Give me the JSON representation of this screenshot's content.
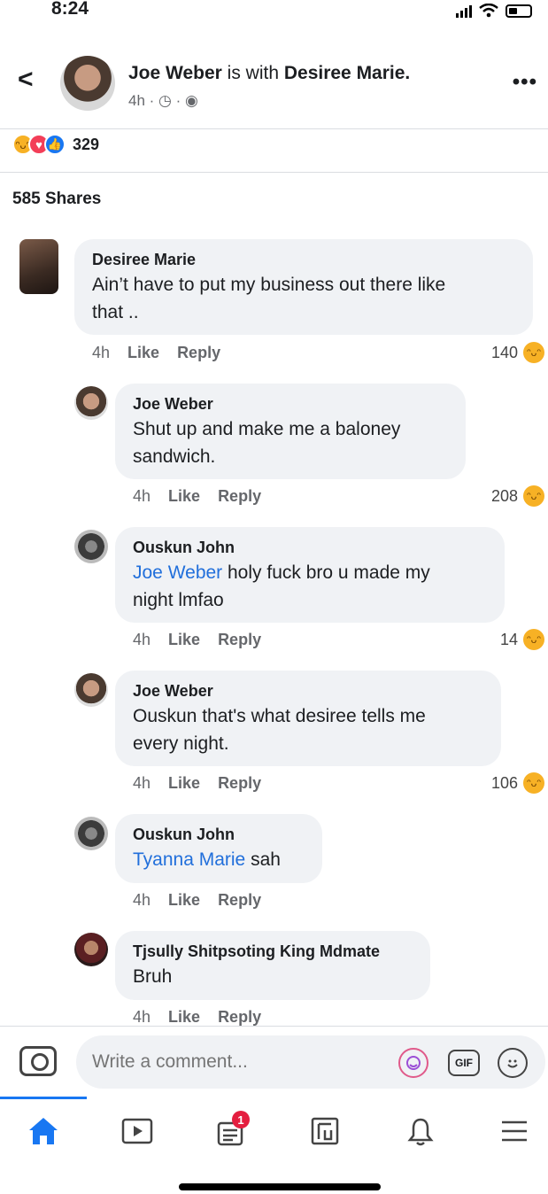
{
  "status_bar": {
    "time": "8:24"
  },
  "header": {
    "author": "Joe Weber",
    "with_text": " is with ",
    "tagged": "Desiree Marie.",
    "meta": "4h · ◷ · ◉"
  },
  "reactions": {
    "count": "329",
    "types": [
      "haha-icon",
      "love-icon",
      "like-icon"
    ]
  },
  "shares": "585 Shares",
  "comments": [
    {
      "name": "Desiree Marie",
      "text_lines": [
        "Ain’t have to put my business out there like",
        "that .."
      ],
      "time": "4h",
      "like": "Like",
      "reply": "Reply",
      "reactions": "140"
    },
    {
      "name": "Joe Weber",
      "text_lines": [
        "Shut up and make me a baloney",
        "sandwich."
      ],
      "time": "4h",
      "like": "Like",
      "reply": "Reply",
      "reactions": "208"
    },
    {
      "name": "Ouskun John",
      "mention": "Joe Weber",
      "text_first": " holy fuck bro u made my",
      "text_second": "night lmfao",
      "time": "4h",
      "like": "Like",
      "reply": "Reply",
      "reactions": "14"
    },
    {
      "name": "Joe Weber",
      "text_lines": [
        "Ouskun that's what desiree tells me",
        "every night."
      ],
      "time": "4h",
      "like": "Like",
      "reply": "Reply",
      "reactions": "106"
    },
    {
      "name": "Ouskun John",
      "mention": "Tyanna Marie",
      "text_first": " sah",
      "time": "4h",
      "like": "Like",
      "reply": "Reply"
    },
    {
      "name": "Tjsully Shitpsoting King Mdmate",
      "text_lines": [
        "Bruh"
      ],
      "time": "4h",
      "like": "Like",
      "reply": "Reply"
    }
  ],
  "composer": {
    "placeholder": "Write a comment...",
    "gif_label": "GIF"
  },
  "nav": {
    "badge_count": "1"
  },
  "colors": {
    "accent": "#1877f2",
    "mention": "#216fdb",
    "bubble": "#f0f2f5",
    "badge": "#e41e3f"
  }
}
